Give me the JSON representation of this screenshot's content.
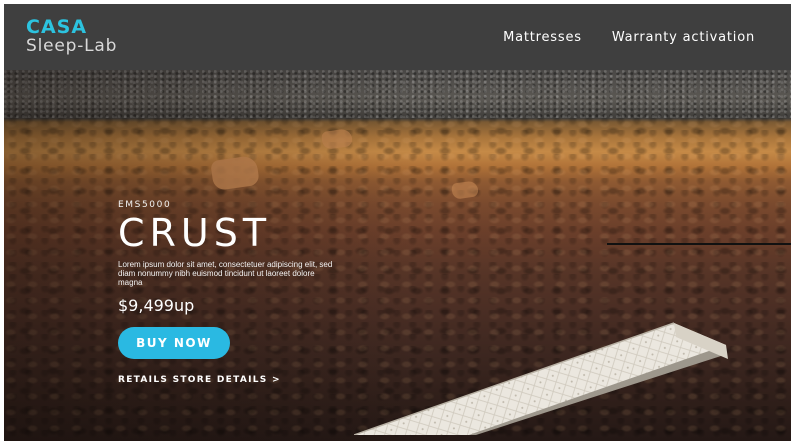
{
  "header": {
    "logo_line1": "CASA",
    "logo_line2": "Sleep-Lab",
    "nav": [
      {
        "label": "Mattresses"
      },
      {
        "label": "Warranty activation"
      }
    ]
  },
  "hero": {
    "model": "EMS5000",
    "title": "CRUST",
    "description": "Lorem ipsum dolor sit amet, consectetuer adipiscing elit, sed diam nonummy nibh euismod tincidunt ut laoreet dolore magna",
    "price": "$9,499up",
    "buy_label": "BUY NOW",
    "store_link_label": "RETAILS STORE DETAILS  >"
  },
  "colors": {
    "brand_cyan": "#2cc3df",
    "header_bg": "#3f3f3f",
    "button_bg": "#2ab9e2"
  }
}
